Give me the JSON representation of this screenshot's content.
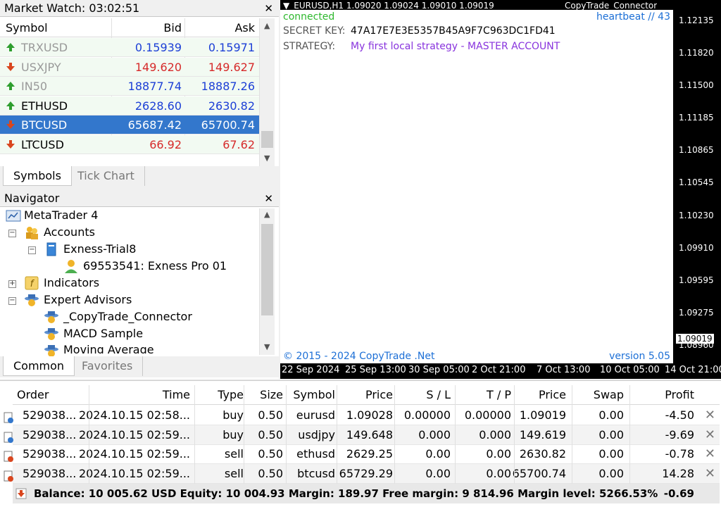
{
  "market_watch": {
    "title": "Market Watch: 03:02:51",
    "columns": {
      "symbol": "Symbol",
      "bid": "Bid",
      "ask": "Ask"
    },
    "rows": [
      {
        "symbol": "TRXUSD",
        "bid": "0.15939",
        "ask": "0.15971",
        "dir": "up"
      },
      {
        "symbol": "USXJPY",
        "bid": "149.620",
        "ask": "149.627",
        "dir": "down"
      },
      {
        "symbol": "IN50",
        "bid": "18877.74",
        "ask": "18887.26",
        "dir": "up"
      },
      {
        "symbol": "ETHUSD",
        "bid": "2628.60",
        "ask": "2630.82",
        "dir": "up"
      },
      {
        "symbol": "BTCUSD",
        "bid": "65687.42",
        "ask": "65700.74",
        "dir": "down"
      },
      {
        "symbol": "LTCUSD",
        "bid": "66.92",
        "ask": "67.62",
        "dir": "down"
      }
    ],
    "tabs": [
      "Symbols",
      "Tick Chart"
    ]
  },
  "navigator": {
    "title": "Navigator",
    "root": "MetaTrader 4",
    "accounts": "Accounts",
    "server": "Exness-Trial8",
    "account": "69553541: Exness Pro 01",
    "indicators": "Indicators",
    "experts": "Expert Advisors",
    "ea_items": [
      "_CopyTrade_Connector",
      "MACD Sample",
      "Moving Average"
    ],
    "tabs": [
      "Common",
      "Favorites"
    ]
  },
  "chart": {
    "header": "EURUSD,H1  1.09020 1.09024 1.09010 1.09019",
    "ea_name": "CopyTrade_Connector",
    "status": "connected",
    "heartbeat": "heartbeat // 43",
    "key_label": "SECRET KEY:",
    "key_value": "47A17E7E3E5357B45A9F7C963DC1FD41",
    "strategy_label": "STRATEGY:",
    "strategy_value": "My first local strategy - MASTER ACCOUNT",
    "copyright": "© 2015 - 2024 CopyTrade .Net",
    "version": "version 5.05",
    "prices": [
      "1.12135",
      "1.11820",
      "1.11500",
      "1.11185",
      "1.10865",
      "1.10545",
      "1.10230",
      "1.09910",
      "1.09595",
      "1.09275",
      "1.09019",
      "1.08960"
    ],
    "dates": [
      "22 Sep 2024",
      "25 Sep 13:00",
      "30 Sep 05:00",
      "2 Oct 21:00",
      "7 Oct 13:00",
      "10 Oct 05:00",
      "14 Oct 21:00"
    ]
  },
  "terminal": {
    "columns": [
      "Order",
      "Time",
      "Type",
      "Size",
      "Symbol",
      "Price",
      "S / L",
      "T / P",
      "Price",
      "Swap",
      "Profit"
    ],
    "rows": [
      [
        "529038...",
        "2024.10.15 02:58...",
        "buy",
        "0.50",
        "eurusd",
        "1.09028",
        "0.00000",
        "0.00000",
        "1.09019",
        "0.00",
        "-4.50"
      ],
      [
        "529038...",
        "2024.10.15 02:59...",
        "buy",
        "0.50",
        "usdjpy",
        "149.648",
        "0.000",
        "0.000",
        "149.619",
        "0.00",
        "-9.69"
      ],
      [
        "529038...",
        "2024.10.15 02:59...",
        "sell",
        "0.50",
        "ethusd",
        "2629.25",
        "0.00",
        "0.00",
        "2630.82",
        "0.00",
        "-0.78"
      ],
      [
        "529038...",
        "2024.10.15 02:59...",
        "sell",
        "0.50",
        "btcusd",
        "65729.29",
        "0.00",
        "0.00",
        "65700.74",
        "0.00",
        "14.28"
      ]
    ],
    "balance_text": "Balance: 10 005.62 USD  Equity: 10 004.93  Margin: 189.97  Free margin: 9 814.96  Margin level: 5266.53%",
    "total_profit": "-0.69"
  },
  "colors": {
    "up": "#2e9e2e",
    "down": "#d9461e",
    "blue_price": "#1c3fd6",
    "red_price": "#d62a2a",
    "status_green": "#2eb82e",
    "purple": "#8833dd"
  }
}
